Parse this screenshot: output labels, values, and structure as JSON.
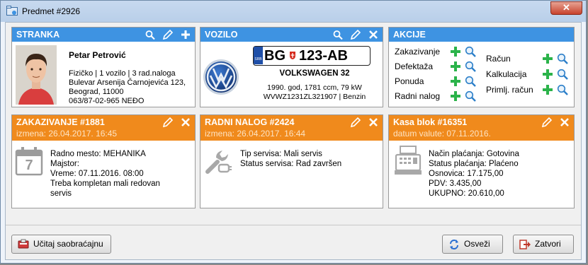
{
  "window": {
    "title": "Predmet  #2926",
    "close_label": "✕"
  },
  "stranka": {
    "header": "STRANKA",
    "name": "Petar Petrović",
    "line1": "Fizičko | 1 vozilo | 3 rad.naloga",
    "line2": "Bulevar Arsenija Čarnojevića 123,",
    "line3": "Beograd, 11000",
    "line4": "063/87-02-965 NEĐO"
  },
  "vozilo": {
    "header": "VOZILO",
    "plate_city": "BG",
    "plate_number": "123-AB",
    "plate_country": "SRB",
    "model": "VOLKSWAGEN 32",
    "specs": "1990. god, 1781 ccm, 79 kW",
    "vin": "WVWZ1231ZL321907 | Benzin"
  },
  "akcije": {
    "header": "AKCIJE",
    "left": [
      "Zakazivanje",
      "Defektaža",
      "Ponuda",
      "Radni nalog"
    ],
    "right": [
      "Račun",
      "Kalkulacija",
      "Primlj. račun"
    ]
  },
  "zakazivanje": {
    "header": "ZAKAZIVANJE   #1881",
    "sub": "izmena: 26.04.2017.  16:45",
    "calendar_day": "7",
    "lines": [
      "Radno mesto: MEHANIKA",
      "Majstor:",
      "Vreme: 07.11.2016.  08:00",
      "Treba kompletan mali redovan",
      "servis"
    ]
  },
  "radni_nalog": {
    "header": "RADNI NALOG   #2424",
    "sub": "izmena: 26.04.2017.  16:44",
    "lines": [
      "Tip servisa: Mali servis",
      "Status servisa: Rad završen"
    ]
  },
  "kasa_blok": {
    "header": "Kasa blok   #16351",
    "sub": "datum valute: 07.11.2016.",
    "lines": [
      "Način plaćanja: Gotovina",
      "Status plaćanja: Plaćeno",
      "Osnovica: 17.175,00",
      "PDV: 3.435,00",
      "UKUPNO: 20.610,00"
    ]
  },
  "buttons": {
    "scan": "Učitaj saobraćajnu",
    "refresh": "Osveži",
    "close": "Zatvori"
  },
  "colors": {
    "blue_header": "#3e93e2",
    "orange_header": "#f08a1c",
    "green_plus": "#2bb34a"
  }
}
